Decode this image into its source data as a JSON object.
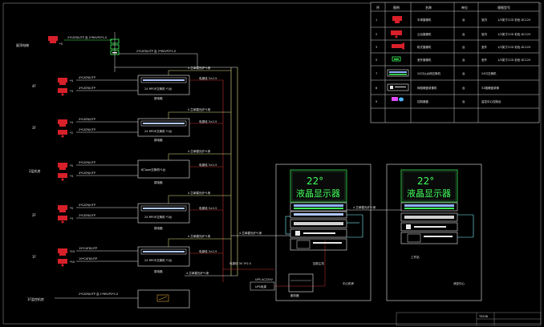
{
  "legend": {
    "headers": [
      "序",
      "图例",
      "名称",
      "单位",
      "规格型号"
    ],
    "rows": [
      {
        "no": "1",
        "icon": "ip-camera-red-icon",
        "name": "半球摄像机",
        "unit": "台",
        "spec1": "室内",
        "spec2": "1/3英寸CCD 彩色 DC12V"
      },
      {
        "no": "2",
        "icon": "ptz-camera-red-icon",
        "name": "云台摄像机",
        "unit": "台",
        "spec1": "室内",
        "spec2": "1/3英寸CCD 彩色 DC12V"
      },
      {
        "no": "3",
        "icon": "bullet-camera-red-icon",
        "name": "枪式摄像机",
        "unit": "台",
        "spec1": "室外",
        "spec2": "1/3英寸CCD 彩色 DC12V"
      },
      {
        "no": "5",
        "icon": "outdoor-camera-green-icon",
        "name": "室外摄像机",
        "unit": "台",
        "spec1": "室外",
        "spec2": "1/3英寸CCD 彩色 DC12V"
      },
      {
        "no": "7",
        "icon": "switch-panel-icon",
        "name": "24口以太网交换机",
        "unit": "台",
        "spec1": "24口交换机",
        "spec2": ""
      },
      {
        "no": "8",
        "icon": "nvr-icon",
        "name": "网络硬盘录像机",
        "unit": "台",
        "spec1": "32路硬盘录像",
        "spec2": ""
      },
      {
        "no": "9",
        "icon": "keyboard-mouse-icon",
        "name": "控制键盘",
        "unit": "台",
        "spec1": "监控中心控制台",
        "spec2": ""
      }
    ]
  },
  "floors": [
    {
      "label": "屋顶电梯",
      "cams": [
        {
          "id": "*5",
          "cable": "2*CAT6/UTP 及 2*RVVP2*1.0"
        }
      ],
      "switch_label": "",
      "power": "",
      "box": ""
    },
    {
      "label": "4F",
      "cams": [
        {
          "id": "*4",
          "cable": "4*CAT6/UTP"
        },
        {
          "id": "*3",
          "cable": "4*CAT6/UTP"
        }
      ],
      "switch_label": "24 RPOE交换机 *1台",
      "power": "电源线 3×2.5",
      "box": "弱电箱"
    },
    {
      "label": "3F",
      "cams": [
        {
          "id": "*4",
          "cable": "5*CAT6/UTP"
        },
        {
          "id": "*2",
          "cable": "2*CAT6/UTP"
        }
      ],
      "switch_label": "24 RPOE交换机 *1台",
      "power": "电源线 3×2.5",
      "box": "弱电箱"
    },
    {
      "label": "2层机房",
      "cams": [
        {
          "id": "*5",
          "cable": "5*CAT6/UTP"
        },
        {
          "id": "*3",
          "cable": "4*CAT6/UTP"
        }
      ],
      "switch_label": "8口poe交换机*1台",
      "power": "电源线 3×2.5",
      "box": "弱电箱"
    },
    {
      "label": "2F",
      "cams": [
        {
          "id": "*5",
          "cable": "5*CAT6/UTP"
        },
        {
          "id": "*3",
          "cable": "2*CAT6/UTP"
        }
      ],
      "switch_label": "24 RPOE交换机 *1台",
      "power": "电源线 3×2.5",
      "box": "弱电箱"
    },
    {
      "label": "1F",
      "cams": [
        {
          "id": "*15",
          "cable": "15*CAT6/UTP"
        },
        {
          "id": "*10",
          "cable": "10*CAT6/UTP"
        }
      ],
      "switch_label": "24 RPOE交换机 *1台",
      "power": "电源线 3×2.5",
      "box": "弱电箱"
    },
    {
      "label": "1F监控机房",
      "cams": [],
      "switch_label": "",
      "power": "",
      "box": "",
      "cable": "2*CAT6/UTP 及 1*RVVP2*1.0"
    }
  ],
  "fiber_labels": [
    "4 芯单模光纤*1条",
    "4 芯单模光纤*1条",
    "4 芯单模光纤*1条",
    "4 芯单模光纤*1条",
    "4 芯单模光纤*1条"
  ],
  "center": {
    "display_temp": "22°",
    "display_text": "液晶显示器",
    "fiber_in": "4 芯单模光纤*1条",
    "power_label": "电源线 3V 3*2.5",
    "ups_label": "UPS AC220V",
    "ups_box": "UPS电源",
    "server_label": "服务器",
    "room_label": "中心机房",
    "branch_label": "4 芯单模光纤*1条",
    "second_room_label": "消控中心",
    "stack_label": "控制主机",
    "pc_label": "工作站"
  },
  "title_block": {
    "code": "TSS36"
  }
}
